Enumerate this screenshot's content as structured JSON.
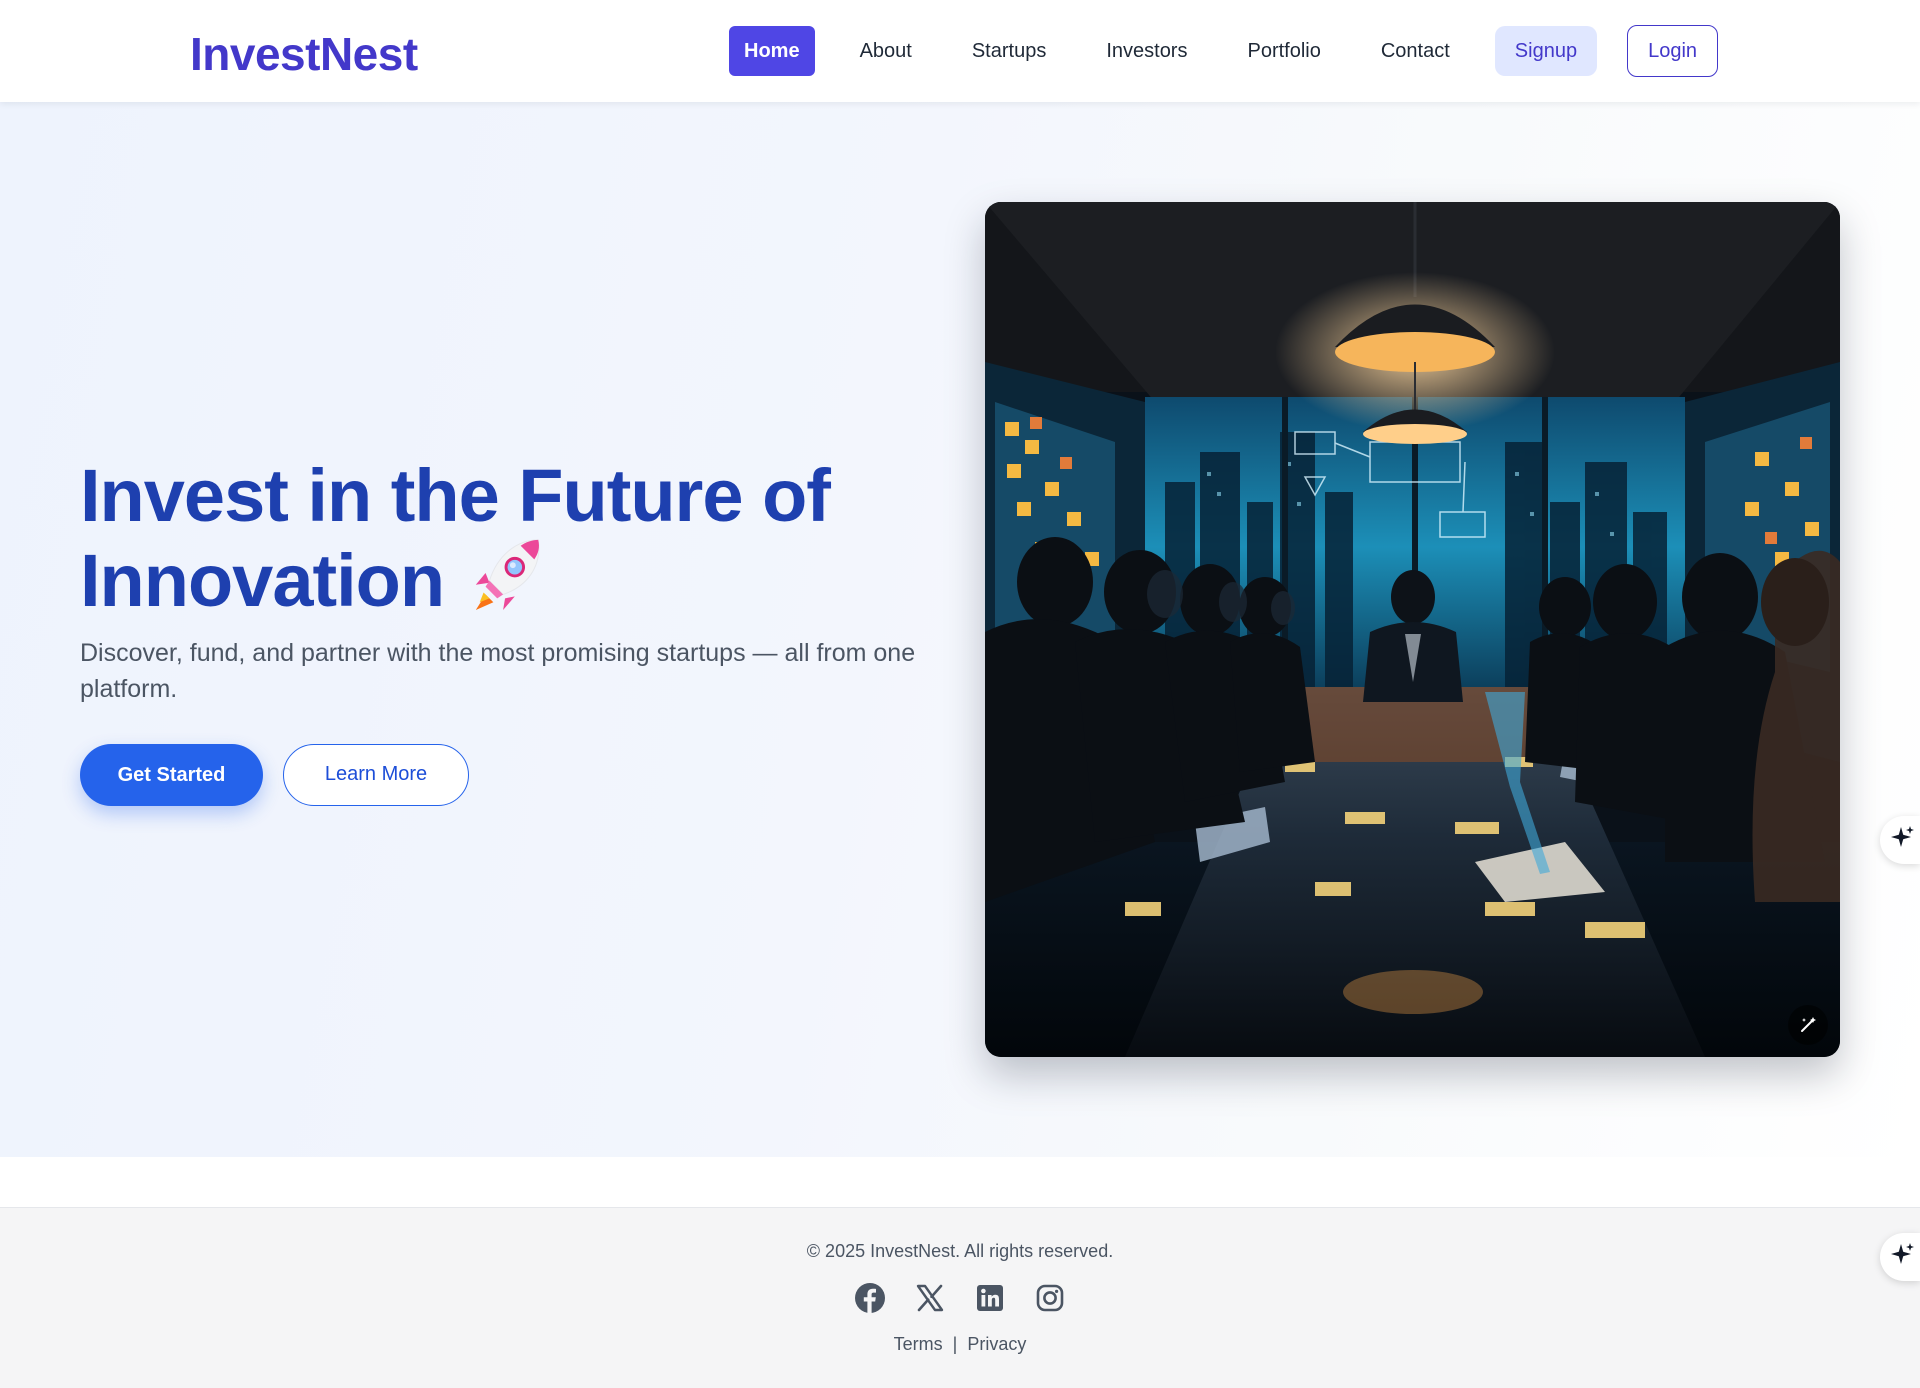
{
  "brand": {
    "name": "InvestNest",
    "color": "#4338ca"
  },
  "nav": {
    "items": [
      {
        "label": "Home",
        "active": true
      },
      {
        "label": "About",
        "active": false
      },
      {
        "label": "Startups",
        "active": false
      },
      {
        "label": "Investors",
        "active": false
      },
      {
        "label": "Portfolio",
        "active": false
      },
      {
        "label": "Contact",
        "active": false
      }
    ],
    "signup_label": "Signup",
    "login_label": "Login"
  },
  "hero": {
    "title_line1": "Invest in the Future of",
    "title_line2": "Innovation",
    "title_icon": "rocket-icon",
    "subtitle": "Discover, fund, and partner with the most promising startups — all from one platform.",
    "primary_cta": "Get Started",
    "secondary_cta": "Learn More",
    "image_icon": "magic-wand-icon"
  },
  "assistant": {
    "icon": "sparkle-icon"
  },
  "footer": {
    "copyright": "© 2025 InvestNest. All rights reserved.",
    "socials": [
      "facebook-icon",
      "x-icon",
      "linkedin-icon",
      "instagram-icon"
    ],
    "links": [
      "Terms",
      "Privacy"
    ],
    "separator": "|"
  },
  "colors": {
    "primary": "#2563eb",
    "nav_active": "#4f46e5",
    "title": "#1e40af",
    "signup_bg": "#e0e7ff"
  }
}
